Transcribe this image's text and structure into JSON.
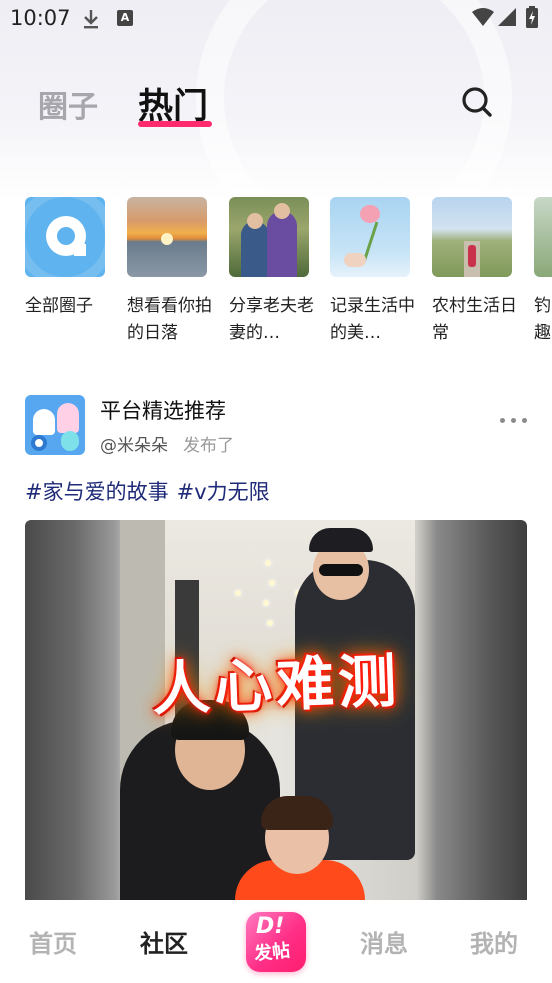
{
  "status_bar": {
    "time": "10:07",
    "a_icon_letter": "A"
  },
  "header": {
    "tabs": [
      {
        "label": "圈子",
        "active": false
      },
      {
        "label": "热门",
        "active": true
      }
    ],
    "accent_color": "#ff2a6d"
  },
  "circles": [
    {
      "label": "全部圈子",
      "icon": "chat-bubble-icon"
    },
    {
      "label": "想看看你拍的日落"
    },
    {
      "label": "分享老夫老妻的…"
    },
    {
      "label": "记录生活中的美…"
    },
    {
      "label": "农村生活日常"
    },
    {
      "label": "钓趣"
    }
  ],
  "post": {
    "title": "平台精选推荐",
    "author": "@米朵朵",
    "action": "发布了",
    "tags": [
      "#家与爱的故事",
      "#v力无限"
    ],
    "tag_color": "#1f2a78",
    "video_caption": "人心难测"
  },
  "bottom_nav": {
    "items": [
      {
        "label": "首页",
        "active": false
      },
      {
        "label": "社区",
        "active": true
      },
      {
        "label": "发帖",
        "badge": "D!"
      },
      {
        "label": "消息",
        "active": false
      },
      {
        "label": "我的",
        "active": false
      }
    ]
  }
}
